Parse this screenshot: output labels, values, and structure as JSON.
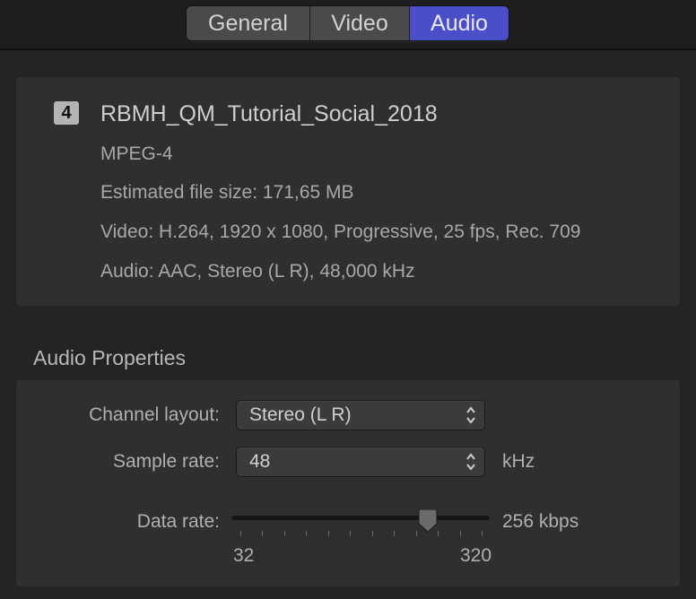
{
  "tabs": [
    {
      "label": "General",
      "selected": false
    },
    {
      "label": "Video",
      "selected": false
    },
    {
      "label": "Audio",
      "selected": true
    }
  ],
  "accent_color": "#4b4fc7",
  "info": {
    "badge": "4",
    "file_name": "RBMH_QM_Tutorial_Social_2018",
    "format": "MPEG-4",
    "file_size": "Estimated file size: 171,65 MB",
    "video": "Video: H.264, 1920 x 1080, Progressive, 25 fps, Rec. 709",
    "audio": "Audio: AAC, Stereo (L R), 48,000 kHz"
  },
  "audio_properties": {
    "title": "Audio Properties",
    "channel_layout": {
      "label": "Channel layout:",
      "value": "Stereo (L R)",
      "icon": "up-down-chevron-icon"
    },
    "sample_rate": {
      "label": "Sample rate:",
      "value": "48",
      "unit": "kHz",
      "icon": "up-down-chevron-icon"
    },
    "data_rate": {
      "label": "Data rate:",
      "value_text": "256 kbps",
      "min_label": "32",
      "max_label": "320",
      "value": 256,
      "min": 32,
      "max": 320,
      "tick_count": 12
    }
  }
}
